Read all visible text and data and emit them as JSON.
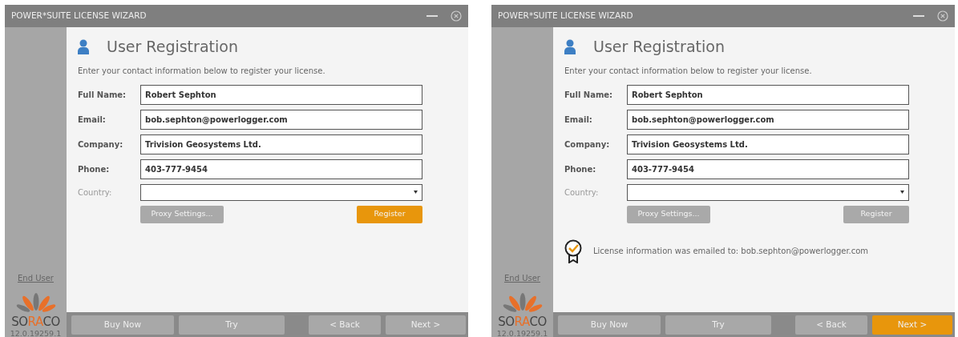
{
  "windows": [
    {
      "title": "POWER*SUITE LICENSE WIZARD",
      "heading": "User Registration",
      "intro": "Enter your contact information below to register your license.",
      "fields": [
        {
          "label": "Full Name:",
          "value": "Robert Sephton",
          "kind": "text",
          "disabled": false
        },
        {
          "label": "Email:",
          "value": "bob.sephton@powerlogger.com",
          "kind": "text",
          "disabled": false
        },
        {
          "label": "Company:",
          "value": "Trivision Geosystems Ltd.",
          "kind": "text",
          "disabled": false
        },
        {
          "label": "Phone:",
          "value": "403-777-9454",
          "kind": "text",
          "disabled": false
        },
        {
          "label": "Country:",
          "kind": "select",
          "disabled": true
        }
      ],
      "actions": [
        {
          "label": "Proxy Settings...",
          "highlighted": false
        },
        {
          "label": "Register",
          "highlighted": true
        }
      ],
      "sidebar": {
        "link": "End User",
        "logo": [
          {
            "text": "SO",
            "accent": false
          },
          {
            "text": "RA",
            "accent": true
          },
          {
            "text": "CO",
            "accent": false
          }
        ],
        "version": "12.0.19259.1"
      },
      "nav": [
        {
          "label": "Buy Now",
          "highlighted": false
        },
        {
          "label": "Try",
          "highlighted": false
        },
        {
          "label": "< Back",
          "highlighted": false
        },
        {
          "label": "Next >",
          "highlighted": false
        }
      ]
    },
    {
      "title": "POWER*SUITE LICENSE WIZARD",
      "heading": "User Registration",
      "intro": "Enter your contact information below to register your license.",
      "fields": [
        {
          "label": "Full Name:",
          "value": "Robert Sephton",
          "kind": "text",
          "disabled": false
        },
        {
          "label": "Email:",
          "value": "bob.sephton@powerlogger.com",
          "kind": "text",
          "disabled": false
        },
        {
          "label": "Company:",
          "value": "Trivision Geosystems Ltd.",
          "kind": "text",
          "disabled": false
        },
        {
          "label": "Phone:",
          "value": "403-777-9454",
          "kind": "text",
          "disabled": false
        },
        {
          "label": "Country:",
          "kind": "select",
          "disabled": true
        }
      ],
      "actions": [
        {
          "label": "Proxy Settings...",
          "highlighted": false
        },
        {
          "label": "Register",
          "highlighted": false
        }
      ],
      "message": "License information was emailed to: bob.sephton@powerlogger.com",
      "sidebar": {
        "link": "End User",
        "logo": [
          {
            "text": "SO",
            "accent": false
          },
          {
            "text": "RA",
            "accent": true
          },
          {
            "text": "CO",
            "accent": false
          }
        ],
        "version": "12.0.19259.1"
      },
      "nav": [
        {
          "label": "Buy Now",
          "highlighted": false
        },
        {
          "label": "Try",
          "highlighted": false
        },
        {
          "label": "< Back",
          "highlighted": false
        },
        {
          "label": "Next >",
          "highlighted": true
        }
      ]
    }
  ]
}
